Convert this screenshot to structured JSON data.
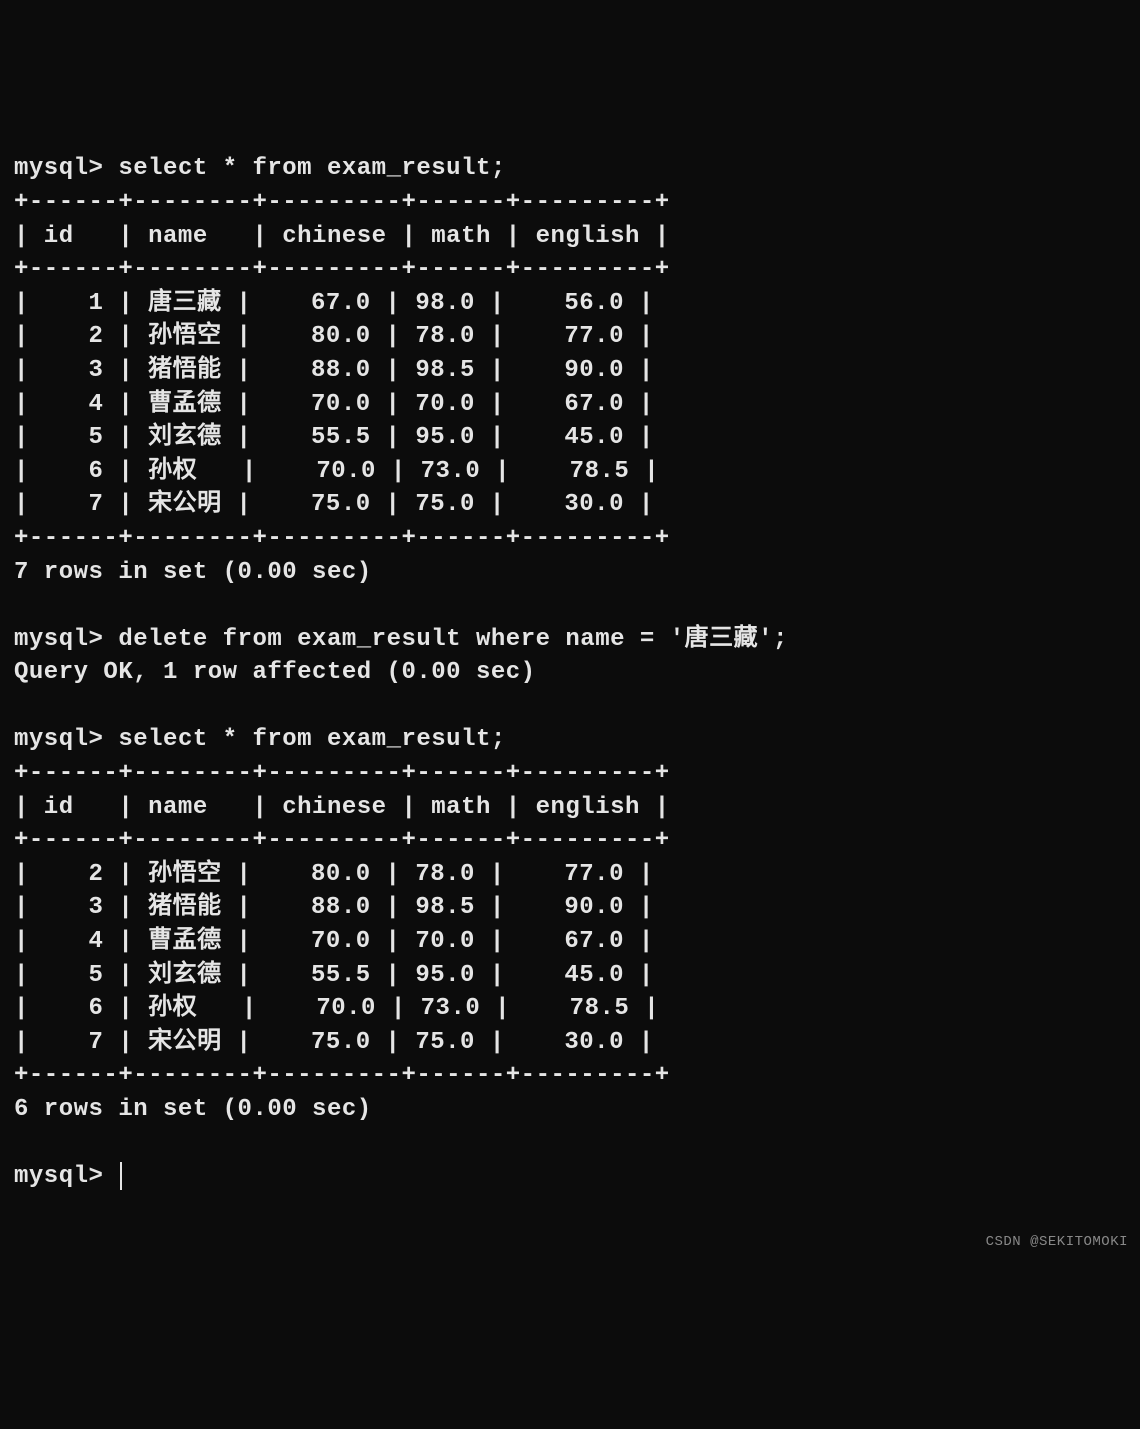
{
  "prompt": "mysql> ",
  "query1": {
    "command": "select * from exam_result;",
    "border_top": "+------+--------+---------+------+---------+",
    "header": "| id   | name   | chinese | math | english |",
    "border_mid": "+------+--------+---------+------+---------+",
    "rows": [
      "|    1 | 唐三藏 |    67.0 | 98.0 |    56.0 |",
      "|    2 | 孙悟空 |    80.0 | 78.0 |    77.0 |",
      "|    3 | 猪悟能 |    88.0 | 98.5 |    90.0 |",
      "|    4 | 曹孟德 |    70.0 | 70.0 |    67.0 |",
      "|    5 | 刘玄德 |    55.5 | 95.0 |    45.0 |",
      "|    6 | 孙权   |    70.0 | 73.0 |    78.5 |",
      "|    7 | 宋公明 |    75.0 | 75.0 |    30.0 |"
    ],
    "border_bot": "+------+--------+---------+------+---------+",
    "result": "7 rows in set (0.00 sec)"
  },
  "query2": {
    "command": "delete from exam_result where name = '唐三藏';",
    "result": "Query OK, 1 row affected (0.00 sec)"
  },
  "query3": {
    "command": "select * from exam_result;",
    "border_top": "+------+--------+---------+------+---------+",
    "header": "| id   | name   | chinese | math | english |",
    "border_mid": "+------+--------+---------+------+---------+",
    "rows": [
      "|    2 | 孙悟空 |    80.0 | 78.0 |    77.0 |",
      "|    3 | 猪悟能 |    88.0 | 98.5 |    90.0 |",
      "|    4 | 曹孟德 |    70.0 | 70.0 |    67.0 |",
      "|    5 | 刘玄德 |    55.5 | 95.0 |    45.0 |",
      "|    6 | 孙权   |    70.0 | 73.0 |    78.5 |",
      "|    7 | 宋公明 |    75.0 | 75.0 |    30.0 |"
    ],
    "border_bot": "+------+--------+---------+------+---------+",
    "result": "6 rows in set (0.00 sec)"
  },
  "watermark": "CSDN @SEKITOMOKI"
}
